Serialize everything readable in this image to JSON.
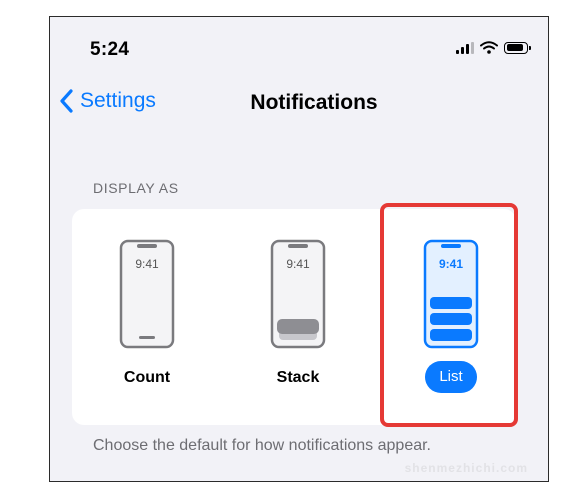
{
  "status_bar": {
    "time": "5:24",
    "icons": [
      "cellular-signal-icon",
      "wifi-icon",
      "battery-icon"
    ]
  },
  "nav": {
    "back_label": "Settings",
    "title": "Notifications"
  },
  "section": {
    "header": "DISPLAY AS"
  },
  "options": [
    {
      "label": "Count",
      "phone_time": "9:41",
      "selected": false
    },
    {
      "label": "Stack",
      "phone_time": "9:41",
      "selected": false
    },
    {
      "label": "List",
      "phone_time": "9:41",
      "selected": true
    }
  ],
  "footer": "Choose the default for how notifications appear.",
  "watermark": "shenmezhichi.com",
  "colors": {
    "accent": "#0a7aff",
    "highlight": "#e53935",
    "background": "#f2f2f7"
  }
}
